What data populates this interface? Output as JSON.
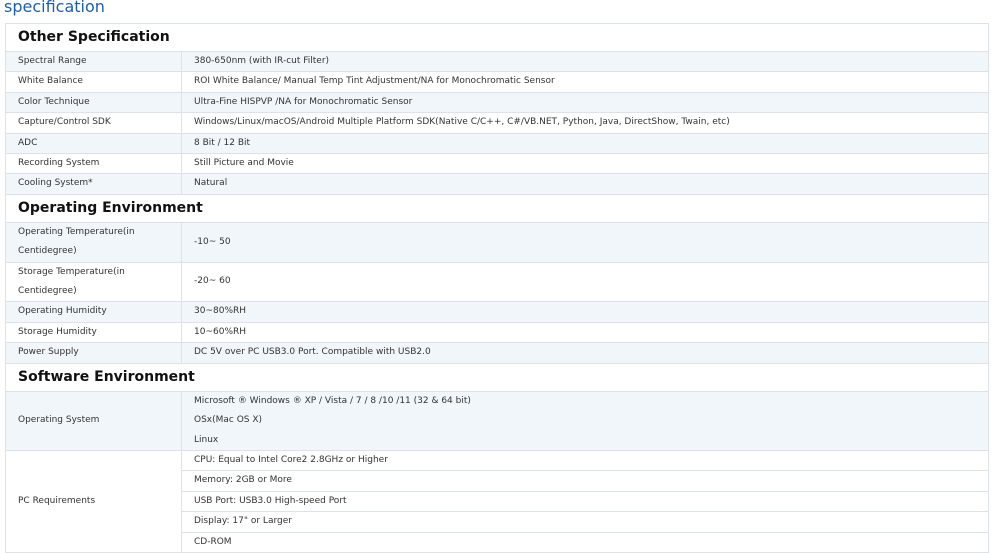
{
  "heading": "specification",
  "sections": [
    {
      "title": "Other Specification",
      "rows": [
        {
          "label": "Spectral Range",
          "value": "380-650nm (with IR-cut Filter)"
        },
        {
          "label": "White Balance",
          "value": "ROI White Balance/ Manual Temp Tint Adjustment/NA for Monochromatic Sensor"
        },
        {
          "label": "Color Technique",
          "value": "Ultra-Fine HISPVP /NA for Monochromatic Sensor"
        },
        {
          "label": "Capture/Control SDK",
          "value": "Windows/Linux/macOS/Android Multiple Platform SDK(Native C/C++, C#/VB.NET, Python, Java, DirectShow, Twain, etc)"
        },
        {
          "label": "ADC",
          "value": "8 Bit / 12 Bit"
        },
        {
          "label": "Recording System",
          "value": "Still Picture and Movie"
        },
        {
          "label": "Cooling System*",
          "value": "Natural"
        }
      ]
    },
    {
      "title": "Operating Environment",
      "rows": [
        {
          "label": "Operating Temperature(in Centidegree)",
          "value": "-10~ 50"
        },
        {
          "label": "Storage Temperature(in Centidegree)",
          "value": "-20~ 60"
        },
        {
          "label": "Operating Humidity",
          "value": "30~80%RH"
        },
        {
          "label": "Storage Humidity",
          "value": "10~60%RH"
        },
        {
          "label": "Power Supply",
          "value": "DC 5V over PC USB3.0 Port. Compatible with USB2.0"
        }
      ]
    },
    {
      "title": "Software Environment",
      "os": {
        "label": "Operating System",
        "lines": [
          "Microsoft ® Windows ® XP / Vista / 7 / 8 /10 /11 (32 & 64 bit)",
          "OSx(Mac OS X)",
          "Linux"
        ]
      },
      "pc": {
        "label": "PC Requirements",
        "lines": [
          "CPU: Equal to Intel Core2 2.8GHz or Higher",
          "Memory: 2GB or More",
          "USB Port: USB3.0 High-speed Port",
          "Display: 17\"  or Larger",
          "CD-ROM"
        ]
      }
    }
  ]
}
